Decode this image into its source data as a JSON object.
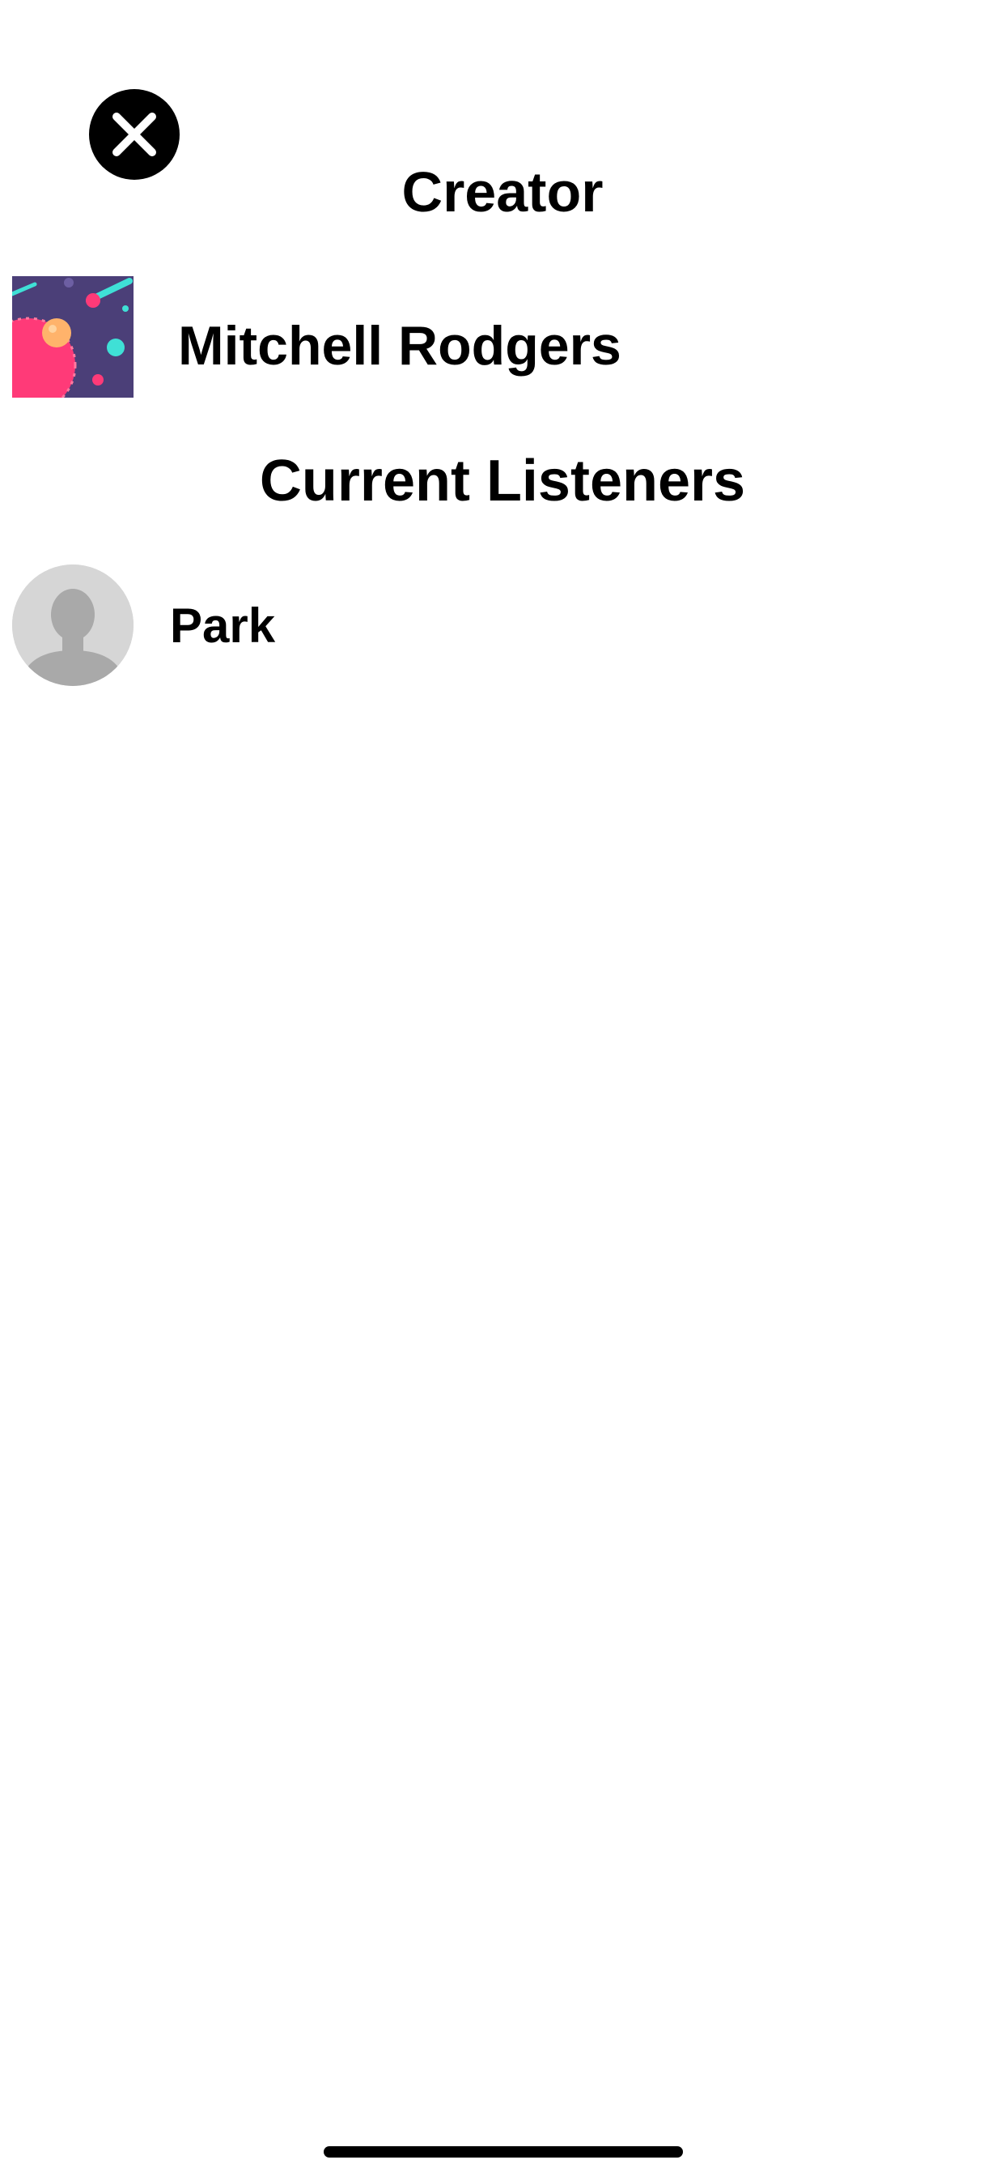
{
  "sheet": {
    "close_icon": "close-icon",
    "creator_title": "Creator",
    "listeners_title": "Current Listeners"
  },
  "creator": {
    "name": "Mitchell Rodgers",
    "thumbnail_icon": "space-planet-artwork",
    "thumbnail_colors": {
      "background": "#4b3f78",
      "planet": "#ff3a78",
      "moon": "#ffb36b",
      "comet": "#3fe0d6"
    }
  },
  "listeners": [
    {
      "name": "Park",
      "avatar_icon": "default-person-icon",
      "avatar_colors": {
        "background": "#d6d6d6",
        "silhouette": "#a9a9a9"
      }
    }
  ]
}
